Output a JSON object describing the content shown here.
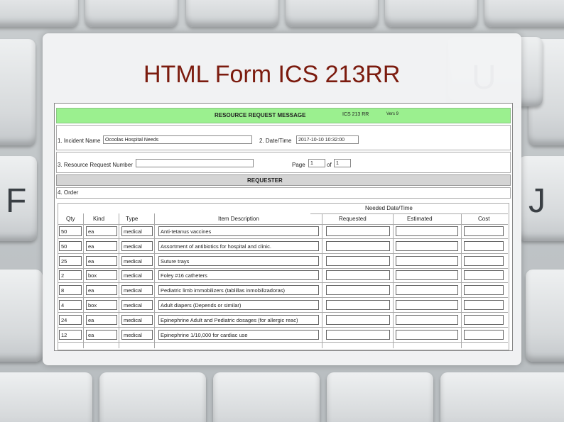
{
  "slide": {
    "title": "HTML Form ICS 213RR"
  },
  "keyboard": {
    "keys": [
      {
        "glyph": "U"
      },
      {
        "glyph": "F"
      },
      {
        "glyph": "J"
      }
    ]
  },
  "form": {
    "header": {
      "title": "RESOURCE REQUEST MESSAGE",
      "form_id": "ICS 213 RR",
      "version": "Vers 9"
    },
    "incident_name": {
      "label": "1. Incident Name",
      "value": "Ocoolas Hospital Needs"
    },
    "date_time": {
      "label": "2. Date/Time",
      "value": "2017-10-10 10:32:00"
    },
    "request_number": {
      "label": "3. Resource Request Number",
      "value": ""
    },
    "page": {
      "label": "Page",
      "current": "1",
      "of_label": "of",
      "total": "1"
    },
    "requester_section": "REQUESTER",
    "order_label": "4. Order",
    "needed_label": "Needed Date/Time",
    "columns": [
      "Qty",
      "Kind",
      "Type",
      "Item Description",
      "Requested",
      "Estimated",
      "Cost"
    ],
    "rows": [
      {
        "qty": "50",
        "kind": "ea",
        "type": "medical",
        "desc": "Anti-tetanus vaccines"
      },
      {
        "qty": "50",
        "kind": "ea",
        "type": "medical",
        "desc": "Assortment of antibiotics for hospital and clinic."
      },
      {
        "qty": "25",
        "kind": "ea",
        "type": "medical",
        "desc": "Suture trays"
      },
      {
        "qty": "2",
        "kind": "box",
        "type": "medical",
        "desc": "Foley #16 catheters"
      },
      {
        "qty": "8",
        "kind": "ea",
        "type": "medical",
        "desc": "Pediatric limb immobilizers (tablillas inmobilizadoras)"
      },
      {
        "qty": "4",
        "kind": "box",
        "type": "medical",
        "desc": "Adult diapers (Depends or similar)"
      },
      {
        "qty": "24",
        "kind": "ea",
        "type": "medical",
        "desc": "Epinephrine Adult and Pediatric dosages (for allergic reac)"
      },
      {
        "qty": "12",
        "kind": "ea",
        "type": "medical",
        "desc": "Epinephrine 1/10,000 for cardiac use"
      }
    ]
  }
}
